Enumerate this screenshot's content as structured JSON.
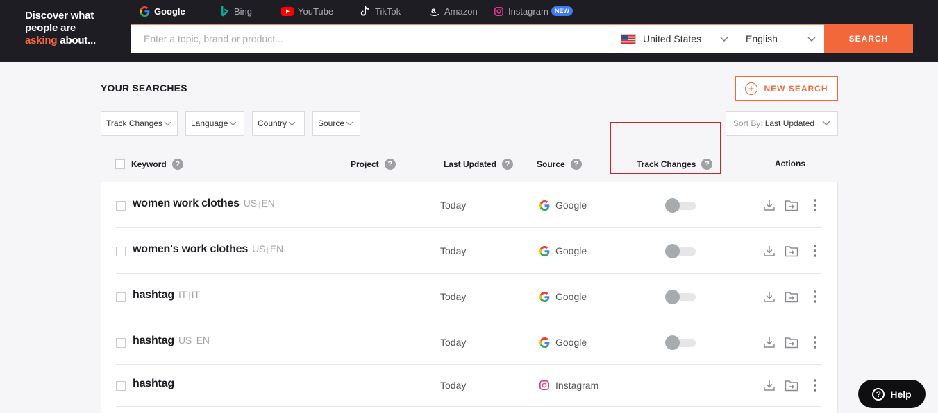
{
  "header": {
    "tagline_line1": "Discover what",
    "tagline_line2": "people are",
    "tagline_accent": "asking",
    "tagline_rest": " about...",
    "engines": [
      {
        "label": "Google",
        "icon": "google-icon",
        "active": true
      },
      {
        "label": "Bing",
        "icon": "bing-icon"
      },
      {
        "label": "YouTube",
        "icon": "youtube-icon"
      },
      {
        "label": "TikTok",
        "icon": "tiktok-icon"
      },
      {
        "label": "Amazon",
        "icon": "amazon-icon"
      },
      {
        "label": "Instagram",
        "icon": "instagram-icon",
        "badge": "NEW"
      }
    ],
    "search": {
      "placeholder": "Enter a topic, brand or product...",
      "value": "",
      "country": "United States",
      "language": "English",
      "button": "SEARCH"
    }
  },
  "main": {
    "title": "YOUR SEARCHES",
    "new_search": "NEW SEARCH",
    "filters": [
      "Track Changes",
      "Language",
      "Country",
      "Source"
    ],
    "sort_label": "Sort By:",
    "sort_value": "Last Updated",
    "columns": {
      "keyword": "Keyword",
      "project": "Project",
      "last_updated": "Last Updated",
      "source": "Source",
      "track_changes": "Track Changes",
      "actions": "Actions"
    },
    "rows": [
      {
        "keyword": "women work clothes",
        "country": "US",
        "language": "EN",
        "updated": "Today",
        "source": "Google",
        "track": false
      },
      {
        "keyword": "women's work clothes",
        "country": "US",
        "language": "EN",
        "updated": "Today",
        "source": "Google",
        "track": false
      },
      {
        "keyword": "hashtag",
        "country": "IT",
        "language": "IT",
        "updated": "Today",
        "source": "Google",
        "track": false
      },
      {
        "keyword": "hashtag",
        "country": "US",
        "language": "EN",
        "updated": "Today",
        "source": "Google",
        "track": false
      },
      {
        "keyword": "hashtag",
        "country": "",
        "language": "",
        "updated": "Today",
        "source": "Instagram",
        "track": null
      }
    ]
  },
  "help": "Help",
  "colors": {
    "accent": "#f2683a",
    "header_bg": "#1e1d24",
    "highlight": "#c8282a"
  }
}
